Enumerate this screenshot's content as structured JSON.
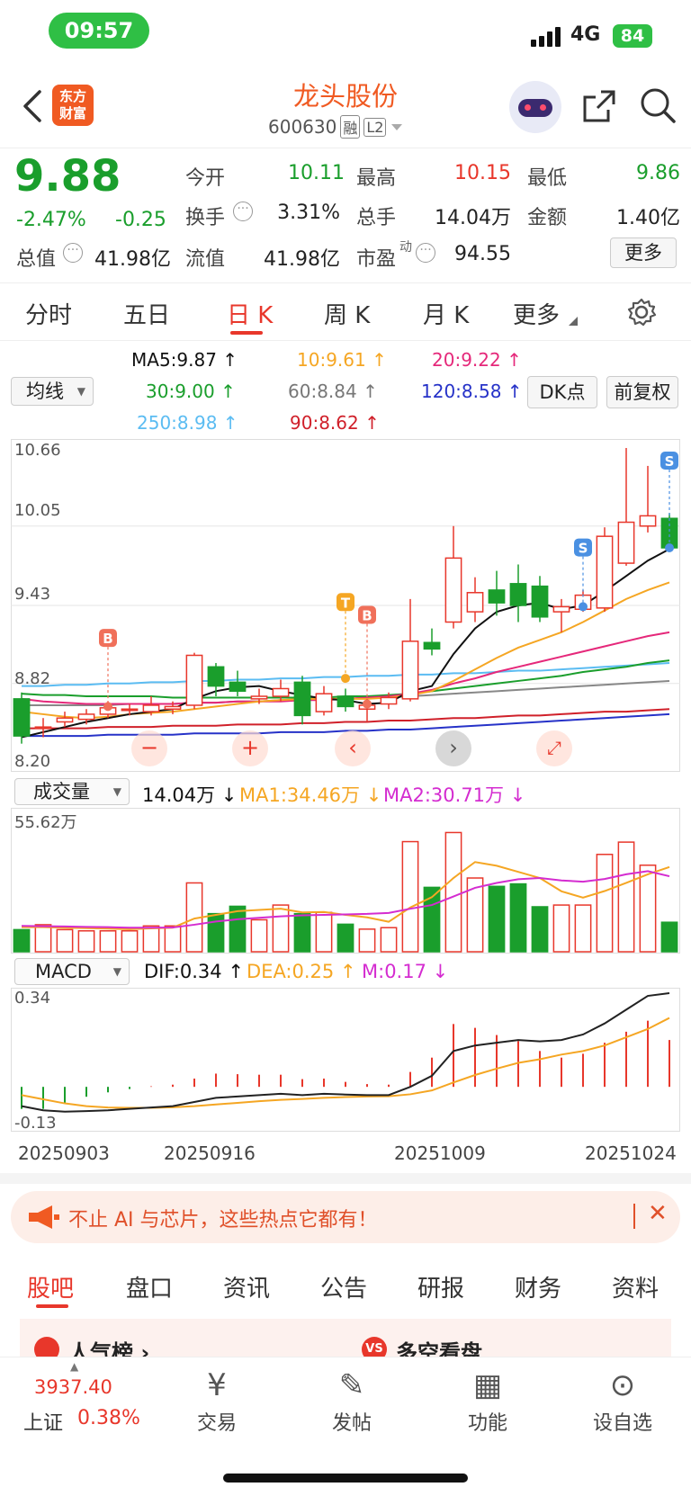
{
  "status": {
    "time": "09:57",
    "network": "4G",
    "battery": "84"
  },
  "header": {
    "app_logo_line1": "东方",
    "app_logo_line2": "财富",
    "stock_name": "龙头股份",
    "stock_code": "600630",
    "badge_rong": "融",
    "badge_l2": "L2"
  },
  "quote": {
    "price": "9.88",
    "change_pct": "-2.47%",
    "change_amt": "-0.25",
    "open_label": "今开",
    "open": "10.11",
    "high_label": "最高",
    "high": "10.15",
    "low_label": "最低",
    "low": "9.86",
    "turnover_label": "换手",
    "turnover": "3.31%",
    "volume_label": "总手",
    "volume": "14.04万",
    "amount_label": "金额",
    "amount": "1.40亿",
    "mcap_label": "总值",
    "mcap": "41.98亿",
    "float_label": "流值",
    "float": "41.98亿",
    "pe_label": "市盈",
    "pe_sup": "动",
    "pe": "94.55",
    "more": "更多"
  },
  "tabs": [
    "分时",
    "五日",
    "日 K",
    "周 K",
    "月 K",
    "更多"
  ],
  "ma": {
    "select": "均线",
    "ma5": "MA5:9.87",
    "ma10": "10:9.61",
    "ma20": "20:9.22",
    "ma30": "30:9.00",
    "ma60": "60:8.84",
    "ma120": "120:8.58",
    "ma250": "250:8.98",
    "ma90": "90:8.62",
    "dk": "DK点",
    "fq": "前复权"
  },
  "kline_axis": {
    "y1": "10.66",
    "y2": "10.05",
    "y3": "9.43",
    "y4": "8.82",
    "y5": "8.20"
  },
  "volume": {
    "select": "成交量",
    "value": "14.04万",
    "ma1": "MA1:34.46万",
    "ma2": "MA2:30.71万",
    "ymax": "55.62万"
  },
  "macd": {
    "select": "MACD",
    "dif": "DIF:0.34",
    "dea": "DEA:0.25",
    "m": "M:0.17",
    "ymax": "0.34",
    "ymin": "-0.13"
  },
  "dates": [
    "20250903",
    "20250916",
    "20251009",
    "20251024"
  ],
  "markers": {
    "b": "B",
    "t": "T",
    "s": "S"
  },
  "banner": {
    "text": "不止 AI 与芯片，这些热点它都有！"
  },
  "bottom_tabs": [
    "股吧",
    "盘口",
    "资讯",
    "公告",
    "研报",
    "财务",
    "资料"
  ],
  "cards": {
    "popular": "人气榜",
    "longshort": "多空看盘"
  },
  "index": {
    "value": "3937.40",
    "name": "上证",
    "pct": "0.38%"
  },
  "nav": [
    "交易",
    "发帖",
    "功能",
    "设自选"
  ],
  "colors": {
    "up": "#e8372b",
    "down": "#1a9e2c",
    "accent": "#f05a22"
  },
  "chart_data": {
    "type": "candlestick",
    "ylim": [
      8.2,
      10.66
    ],
    "candles": [
      {
        "o": 8.7,
        "c": 8.41,
        "h": 8.75,
        "l": 8.35
      },
      {
        "o": 8.47,
        "c": 8.48,
        "h": 8.55,
        "l": 8.4
      },
      {
        "o": 8.52,
        "c": 8.55,
        "h": 8.6,
        "l": 8.48
      },
      {
        "o": 8.54,
        "c": 8.58,
        "h": 8.62,
        "l": 8.5
      },
      {
        "o": 8.58,
        "c": 8.63,
        "h": 8.68,
        "l": 8.55
      },
      {
        "o": 8.61,
        "c": 8.62,
        "h": 8.66,
        "l": 8.57
      },
      {
        "o": 8.6,
        "c": 8.65,
        "h": 8.72,
        "l": 8.57
      },
      {
        "o": 8.62,
        "c": 8.64,
        "h": 8.68,
        "l": 8.58
      },
      {
        "o": 8.65,
        "c": 9.04,
        "h": 9.06,
        "l": 8.62
      },
      {
        "o": 8.95,
        "c": 8.8,
        "h": 8.98,
        "l": 8.72
      },
      {
        "o": 8.83,
        "c": 8.76,
        "h": 8.92,
        "l": 8.72
      },
      {
        "o": 8.7,
        "c": 8.72,
        "h": 8.78,
        "l": 8.66
      },
      {
        "o": 8.72,
        "c": 8.78,
        "h": 8.85,
        "l": 8.68
      },
      {
        "o": 8.83,
        "c": 8.57,
        "h": 8.88,
        "l": 8.5
      },
      {
        "o": 8.6,
        "c": 8.74,
        "h": 8.8,
        "l": 8.57
      },
      {
        "o": 8.72,
        "c": 8.64,
        "h": 8.78,
        "l": 8.6
      },
      {
        "o": 8.62,
        "c": 8.65,
        "h": 8.7,
        "l": 8.52
      },
      {
        "o": 8.66,
        "c": 8.71,
        "h": 8.75,
        "l": 8.62
      },
      {
        "o": 8.7,
        "c": 9.15,
        "h": 9.48,
        "l": 8.68
      },
      {
        "o": 9.14,
        "c": 9.09,
        "h": 9.25,
        "l": 9.04
      },
      {
        "o": 9.3,
        "c": 9.8,
        "h": 10.05,
        "l": 9.25
      },
      {
        "o": 9.38,
        "c": 9.53,
        "h": 9.65,
        "l": 9.3
      },
      {
        "o": 9.55,
        "c": 9.45,
        "h": 9.7,
        "l": 9.35
      },
      {
        "o": 9.6,
        "c": 9.43,
        "h": 9.75,
        "l": 9.3
      },
      {
        "o": 9.58,
        "c": 9.34,
        "h": 9.66,
        "l": 9.3
      },
      {
        "o": 9.38,
        "c": 9.42,
        "h": 9.48,
        "l": 9.22
      },
      {
        "o": 9.4,
        "c": 9.51,
        "h": 9.55,
        "l": 9.38
      },
      {
        "o": 9.41,
        "c": 9.97,
        "h": 10.04,
        "l": 9.38
      },
      {
        "o": 9.76,
        "c": 10.08,
        "h": 10.66,
        "l": 9.74
      },
      {
        "o": 10.05,
        "c": 10.13,
        "h": 10.52,
        "l": 10.0
      },
      {
        "o": 10.11,
        "c": 9.88,
        "h": 10.15,
        "l": 9.86
      }
    ],
    "ma5": [
      8.4,
      8.44,
      8.48,
      8.52,
      8.55,
      8.58,
      8.6,
      8.62,
      8.7,
      8.76,
      8.79,
      8.8,
      8.76,
      8.73,
      8.7,
      8.69,
      8.66,
      8.67,
      8.76,
      8.8,
      9.05,
      9.25,
      9.38,
      9.43,
      9.45,
      9.4,
      9.43,
      9.54,
      9.66,
      9.78,
      9.87
    ],
    "ma10": [
      8.6,
      8.58,
      8.56,
      8.55,
      8.56,
      8.58,
      8.59,
      8.6,
      8.62,
      8.64,
      8.66,
      8.68,
      8.69,
      8.7,
      8.7,
      8.7,
      8.7,
      8.71,
      8.73,
      8.76,
      8.84,
      8.93,
      9.02,
      9.1,
      9.16,
      9.22,
      9.3,
      9.39,
      9.48,
      9.55,
      9.61
    ],
    "ma20": [
      8.7,
      8.68,
      8.67,
      8.66,
      8.66,
      8.66,
      8.66,
      8.66,
      8.67,
      8.67,
      8.68,
      8.68,
      8.68,
      8.69,
      8.69,
      8.7,
      8.71,
      8.72,
      8.74,
      8.77,
      8.82,
      8.86,
      8.91,
      8.95,
      8.99,
      9.03,
      9.07,
      9.11,
      9.15,
      9.19,
      9.22
    ],
    "ma30": [
      8.74,
      8.73,
      8.73,
      8.72,
      8.72,
      8.72,
      8.72,
      8.71,
      8.71,
      8.71,
      8.71,
      8.71,
      8.71,
      8.71,
      8.71,
      8.72,
      8.72,
      8.73,
      8.74,
      8.76,
      8.78,
      8.8,
      8.82,
      8.84,
      8.86,
      8.88,
      8.91,
      8.93,
      8.95,
      8.98,
      9.0
    ],
    "ma60": [
      8.65,
      8.65,
      8.65,
      8.65,
      8.65,
      8.66,
      8.66,
      8.66,
      8.67,
      8.67,
      8.68,
      8.68,
      8.69,
      8.69,
      8.7,
      8.7,
      8.71,
      8.71,
      8.72,
      8.73,
      8.74,
      8.75,
      8.76,
      8.77,
      8.78,
      8.79,
      8.8,
      8.81,
      8.82,
      8.83,
      8.84
    ],
    "ma90": [
      8.47,
      8.47,
      8.47,
      8.47,
      8.48,
      8.48,
      8.48,
      8.49,
      8.49,
      8.49,
      8.5,
      8.5,
      8.5,
      8.51,
      8.51,
      8.52,
      8.52,
      8.53,
      8.53,
      8.54,
      8.55,
      8.55,
      8.56,
      8.57,
      8.57,
      8.58,
      8.59,
      8.6,
      8.6,
      8.61,
      8.62
    ],
    "ma120": [
      8.41,
      8.41,
      8.41,
      8.41,
      8.42,
      8.42,
      8.42,
      8.42,
      8.43,
      8.43,
      8.43,
      8.43,
      8.44,
      8.44,
      8.44,
      8.45,
      8.45,
      8.46,
      8.46,
      8.47,
      8.48,
      8.49,
      8.5,
      8.51,
      8.52,
      8.53,
      8.54,
      8.55,
      8.56,
      8.57,
      8.58
    ],
    "ma250": [
      8.8,
      8.8,
      8.81,
      8.81,
      8.82,
      8.82,
      8.83,
      8.83,
      8.84,
      8.84,
      8.85,
      8.85,
      8.86,
      8.86,
      8.87,
      8.87,
      8.88,
      8.88,
      8.89,
      8.89,
      8.9,
      8.9,
      8.91,
      8.92,
      8.92,
      8.93,
      8.94,
      8.95,
      8.96,
      8.97,
      8.98
    ],
    "volume_ylim": [
      0,
      55.62
    ],
    "volumes": [
      9,
      11,
      9,
      8.5,
      8.5,
      8.5,
      10.5,
      10.5,
      28,
      15.5,
      18.5,
      13,
      19,
      15.5,
      16,
      11.2,
      9.2,
      9.8,
      44.8,
      26.2,
      48.5,
      30,
      26.6,
      27.6,
      18.3,
      19,
      19,
      39.6,
      44.6,
      35.2,
      12
    ],
    "vol_ma1": [
      10,
      10,
      9.8,
      9.6,
      9.4,
      9.2,
      9.5,
      9.8,
      13.5,
      15,
      16.5,
      17,
      17.5,
      16,
      16.2,
      15,
      14,
      12.2,
      18,
      22.2,
      30,
      36.5,
      35,
      32.5,
      30,
      24.6,
      22,
      24.7,
      28,
      31.5,
      34.46
    ],
    "vol_ma2": [
      10.5,
      10.4,
      10.3,
      10.1,
      10,
      9.8,
      9.8,
      9.9,
      11,
      12.3,
      13.2,
      13.8,
      14.4,
      14.8,
      15,
      15.2,
      15.4,
      15.8,
      17.5,
      19,
      22.5,
      26,
      28,
      29.5,
      30,
      29,
      28.5,
      29.6,
      31.5,
      32.8,
      30.71
    ],
    "macd_ylim": [
      -0.13,
      0.34
    ],
    "dif": [
      -0.07,
      -0.085,
      -0.09,
      -0.088,
      -0.085,
      -0.08,
      -0.075,
      -0.07,
      -0.055,
      -0.04,
      -0.035,
      -0.03,
      -0.025,
      -0.03,
      -0.025,
      -0.028,
      -0.03,
      -0.03,
      0.0,
      0.04,
      0.13,
      0.15,
      0.16,
      0.17,
      0.165,
      0.17,
      0.19,
      0.23,
      0.28,
      0.33,
      0.34
    ],
    "dea": [
      -0.03,
      -0.045,
      -0.06,
      -0.07,
      -0.075,
      -0.076,
      -0.076,
      -0.074,
      -0.07,
      -0.064,
      -0.058,
      -0.052,
      -0.047,
      -0.044,
      -0.04,
      -0.037,
      -0.035,
      -0.034,
      -0.027,
      -0.013,
      0.016,
      0.043,
      0.066,
      0.087,
      0.1,
      0.117,
      0.13,
      0.15,
      0.18,
      0.21,
      0.25
    ],
    "macd_hist": [
      -0.08,
      -0.08,
      -0.06,
      -0.036,
      -0.02,
      -0.008,
      0.002,
      0.008,
      0.03,
      0.048,
      0.046,
      0.044,
      0.044,
      0.028,
      0.03,
      0.018,
      0.01,
      0.008,
      0.054,
      0.106,
      0.228,
      0.214,
      0.188,
      0.166,
      0.13,
      0.106,
      0.12,
      0.16,
      0.2,
      0.24,
      0.17
    ]
  }
}
